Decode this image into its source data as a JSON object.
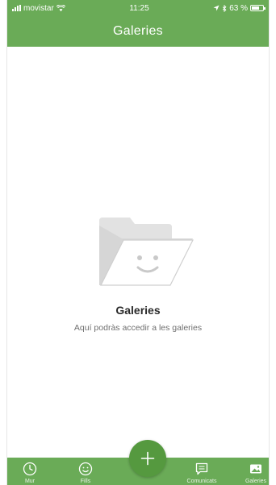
{
  "status_bar": {
    "carrier": "movistar",
    "time": "11:25",
    "battery": "63 %"
  },
  "header": {
    "title": "Galeries"
  },
  "empty_state": {
    "title": "Galeries",
    "subtitle": "Aquí podràs accedir a les galeries"
  },
  "tabbar": {
    "tabs": [
      {
        "label": "Mur",
        "icon": "clock-icon"
      },
      {
        "label": "Fills",
        "icon": "smiley-icon"
      },
      {
        "label": "Comunicats",
        "icon": "message-icon"
      },
      {
        "label": "Galeries",
        "icon": "gallery-icon"
      }
    ],
    "fab_icon": "plus-icon"
  },
  "colors": {
    "accent": "#6aab57",
    "fab": "#55993f"
  }
}
